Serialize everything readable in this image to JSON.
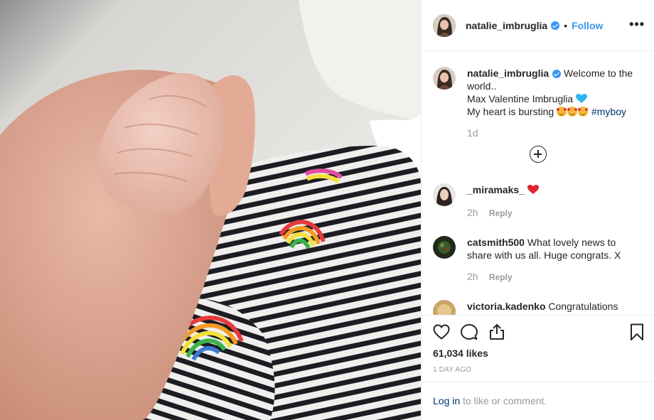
{
  "post": {
    "username": "natalie_imbruglia",
    "follow_label": "Follow",
    "separator": "•",
    "more_label": "•••",
    "caption": {
      "username": "natalie_imbruglia",
      "line1": "Welcome to the world..",
      "line2": "Max Valentine Imbruglia",
      "line3": "My heart is bursting",
      "hashtag": "#myboy",
      "time": "1d"
    },
    "comments": [
      {
        "username": "_miramaks_",
        "text": "",
        "time": "2h",
        "reply_label": "Reply"
      },
      {
        "username": "catsmith500",
        "text": "What lovely news to share with us all. Huge congrats. X",
        "time": "2h",
        "reply_label": "Reply"
      },
      {
        "username": "victoria.kadenko",
        "text": "Congratulations"
      }
    ],
    "likes": "61,034 likes",
    "date": "1 DAY AGO",
    "login": {
      "link": "Log in",
      "rest": " to like or comment."
    }
  },
  "icons": {
    "like": "heart-outline-icon",
    "comment": "speech-bubble-icon",
    "share": "share-upload-icon",
    "save": "bookmark-icon",
    "load_more": "plus-circle-icon"
  },
  "colors": {
    "link_blue": "#3897f0",
    "hashtag": "#003569",
    "muted": "#999999"
  }
}
